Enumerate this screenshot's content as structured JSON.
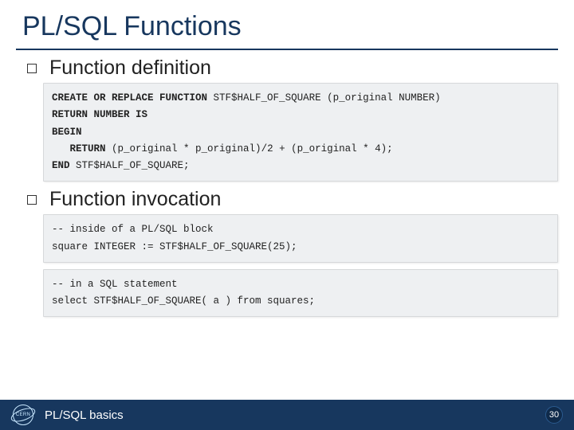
{
  "title": "PL/SQL Functions",
  "sections": [
    {
      "heading": "Function definition",
      "code_blocks": [
        "<b>CREATE OR REPLACE FUNCTION</b> STF$HALF_OF_SQUARE (p_original NUMBER)\n<b>RETURN NUMBER IS</b>\n<b>BEGIN</b>\n   <b>RETURN</b> (p_original * p_original)/2 + (p_original * 4);\n<b>END</b> STF$HALF_OF_SQUARE;"
      ]
    },
    {
      "heading": "Function invocation",
      "code_blocks": [
        "-- inside of a PL/SQL block\nsquare INTEGER := STF$HALF_OF_SQUARE(25);",
        "-- in a SQL statement\nselect STF$HALF_OF_SQUARE( a ) from squares;"
      ]
    }
  ],
  "footer": {
    "logo_text": "CERN",
    "text": "PL/SQL basics",
    "page_number": "30"
  }
}
